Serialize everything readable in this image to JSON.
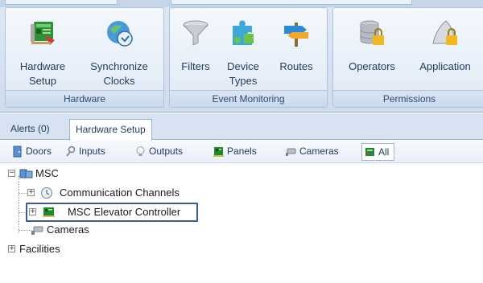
{
  "ribbon": {
    "groups": [
      {
        "label": "Hardware",
        "buttons": [
          {
            "label": "Hardware\nSetup",
            "icon": "hardware-setup-icon"
          },
          {
            "label": "Synchronize\nClocks",
            "icon": "sync-clock-icon"
          }
        ]
      },
      {
        "label": "Event Monitoring",
        "buttons": [
          {
            "label": "Filters",
            "icon": "funnel-icon"
          },
          {
            "label": "Device\nTypes",
            "icon": "puzzle-icon"
          },
          {
            "label": "Routes",
            "icon": "signpost-icon"
          }
        ]
      },
      {
        "label": "Permissions",
        "buttons": [
          {
            "label": "Operators",
            "icon": "locked-database-icon"
          },
          {
            "label": "Application",
            "icon": "locked-app-icon"
          }
        ]
      }
    ]
  },
  "doc_tabs": [
    "Alerts (0)",
    "Hardware Setup"
  ],
  "active_doc_tab": "Hardware Setup",
  "filters": [
    {
      "label": "Doors",
      "icon": "door-icon"
    },
    {
      "label": "Inputs",
      "icon": "input-icon"
    },
    {
      "label": "Outputs",
      "icon": "bulb-icon"
    },
    {
      "label": "Panels",
      "icon": "panel-board-icon"
    },
    {
      "label": "Cameras",
      "icon": "camera-icon"
    },
    {
      "label": "All",
      "icon": "all-icon"
    }
  ],
  "active_filter": "All",
  "tree": {
    "root": {
      "label": "MSC",
      "expanded": true
    },
    "items": [
      {
        "label": "Communication Channels",
        "expanded": false
      },
      {
        "label": "MSC Elevator Controller",
        "expanded": false,
        "selected": true
      },
      {
        "label": "Cameras"
      }
    ],
    "siblings": [
      {
        "label": "Facilities",
        "expanded": false
      }
    ]
  },
  "colors": {
    "accent": "#3d5c95",
    "ribbon_bg": "#dfe9f5",
    "panel_green": "#1f8a2c"
  }
}
